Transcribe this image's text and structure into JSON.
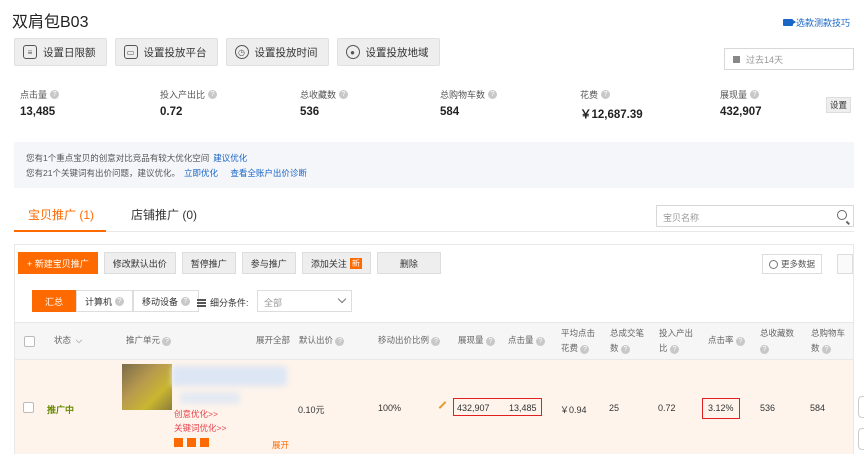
{
  "page": {
    "title": "双肩包B03",
    "tips_link": "选款测款技巧",
    "date_range": "过去14天"
  },
  "toolbar": {
    "buttons": [
      {
        "label": "设置日限额",
        "icon": "limit-icon"
      },
      {
        "label": "设置投放平台",
        "icon": "platform-icon"
      },
      {
        "label": "设置投放时间",
        "icon": "clock-icon"
      },
      {
        "label": "设置投放地域",
        "icon": "location-icon"
      }
    ]
  },
  "metrics": [
    {
      "label": "点击量",
      "value": "13,485"
    },
    {
      "label": "投入产出比",
      "value": "0.72"
    },
    {
      "label": "总收藏数",
      "value": "536"
    },
    {
      "label": "总购物车数",
      "value": "584"
    },
    {
      "label": "花费",
      "value": "￥12,687.39"
    },
    {
      "label": "展现量",
      "value": "432,907"
    }
  ],
  "settings_label": "设置",
  "notice": {
    "line1": "您有1个重点宝贝的创意对比竞品有较大优化空间",
    "line1_link": "建议优化",
    "line2": "您有21个关键词有出价问题，建议优化。",
    "line2_link1": "立即优化",
    "line2_link2": "查看全账户出价诊断"
  },
  "tabs": [
    {
      "label": "宝贝推广  (1)"
    },
    {
      "label": "店铺推广  (0)"
    }
  ],
  "search": {
    "placeholder": "宝贝名称"
  },
  "actions": {
    "new_item": "+ 新建宝贝推广",
    "edit_bid": "修改默认出价",
    "pause": "暂停推广",
    "join": "参与推广",
    "follow": "添加关注",
    "follow_badge": "新",
    "delete": "删除",
    "more_data": "更多数据"
  },
  "segments": {
    "all": "汇总",
    "pc": "计算机",
    "mobile": "移动设备",
    "sub_condition": "细分条件:",
    "select_value": "全部"
  },
  "table": {
    "headers": {
      "status": "状态",
      "unit": "推广单元",
      "expand_all": "展开全部",
      "default_bid": "默认出价",
      "mobile_ratio": "移动出价比例",
      "impressions": "展现量",
      "clicks": "点击量",
      "avg_cpc_1": "平均点击",
      "avg_cpc_2": "花费",
      "total_deals_1": "总成交笔",
      "total_deals_2": "数",
      "roi_1": "投入产出",
      "roi_2": "比",
      "ctr": "点击率",
      "fav_1": "总收藏数",
      "cart_1": "总购物车",
      "cart_2": "数"
    },
    "row": {
      "status": "推广中",
      "link1": "创意优化>>",
      "link2": "关键词优化>>",
      "expand": "展开",
      "default_bid": "0.10元",
      "mobile_ratio": "100%",
      "impressions": "432,907",
      "clicks": "13,485",
      "avg_cpc": "￥0.94",
      "total_deals": "25",
      "roi": "0.72",
      "ctr": "3.12%",
      "favorites": "536",
      "carts": "584"
    }
  },
  "colors": {
    "accent": "#ff6a00",
    "link": "#1a66c7",
    "highlight_box": "#e02020"
  }
}
